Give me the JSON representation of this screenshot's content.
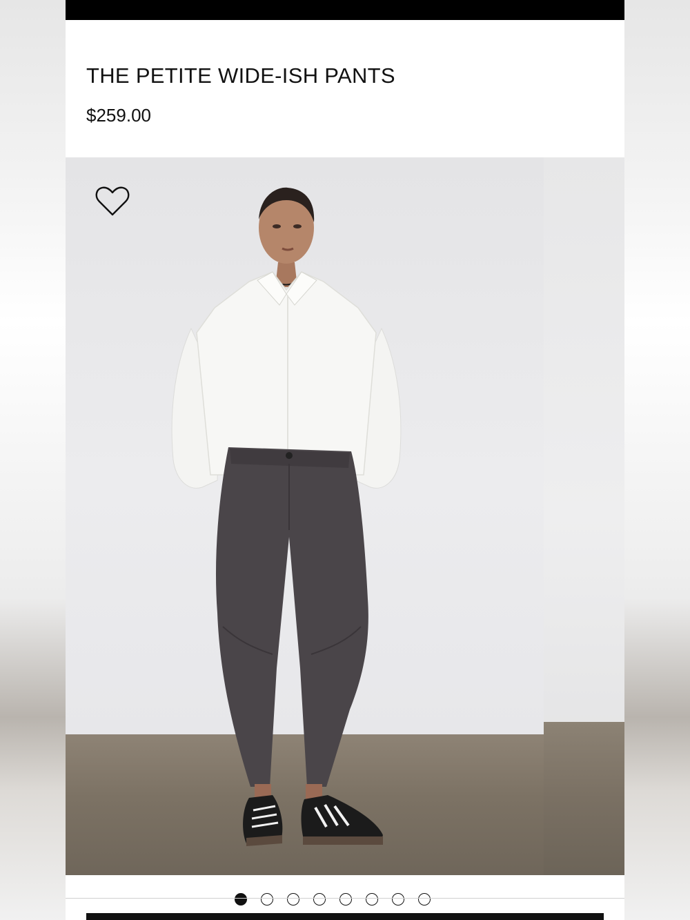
{
  "product": {
    "title": "THE PETITE WIDE-ISH PANTS",
    "price": "$259.00"
  },
  "gallery": {
    "wishlist_icon": "heart-outline-icon",
    "image_alt": "Model wearing white oversized shirt and dark charcoal wide-ish pants with black sneakers",
    "dots": [
      {
        "active": true
      },
      {
        "active": false
      },
      {
        "active": false
      },
      {
        "active": false
      },
      {
        "active": false
      },
      {
        "active": false
      },
      {
        "active": false
      },
      {
        "active": false
      }
    ]
  },
  "colors": {
    "shirt": "#f7f7f5",
    "pants": "#4a4549",
    "floor": "#7c7264",
    "wall": "#ececee"
  }
}
